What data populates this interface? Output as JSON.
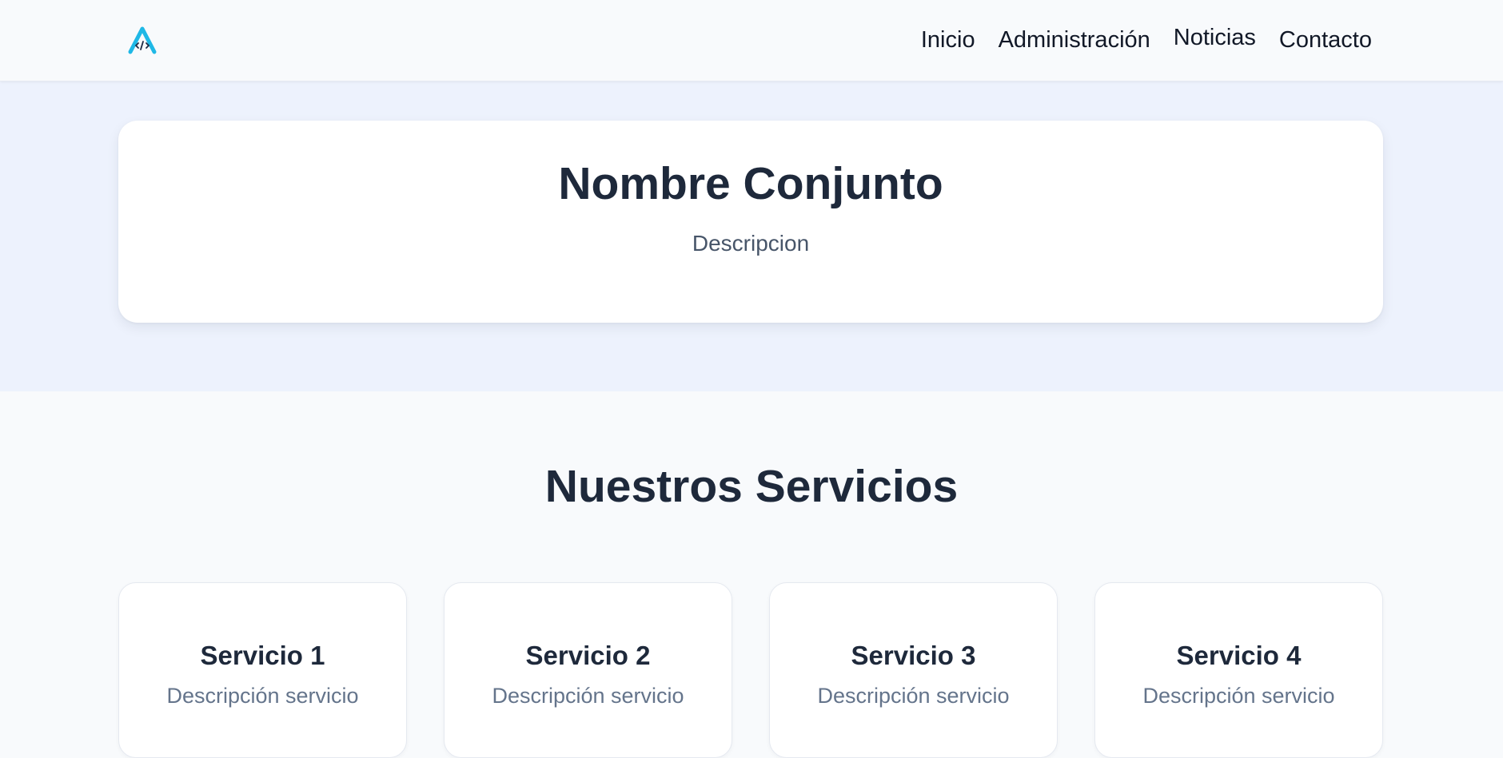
{
  "header": {
    "logo_icon": "code-a-logo-icon",
    "nav": [
      {
        "label": "Inicio"
      },
      {
        "label": "Administración"
      },
      {
        "label": "Noticias"
      },
      {
        "label": "Contacto"
      }
    ]
  },
  "hero": {
    "title": "Nombre Conjunto",
    "description": "Descripcion"
  },
  "services": {
    "title": "Nuestros Servicios",
    "items": [
      {
        "title": "Servicio 1",
        "description": "Descripción servicio"
      },
      {
        "title": "Servicio 2",
        "description": "Descripción servicio"
      },
      {
        "title": "Servicio 3",
        "description": "Descripción servicio"
      },
      {
        "title": "Servicio 4",
        "description": "Descripción servicio"
      }
    ]
  },
  "colors": {
    "accent": "#1fb8e6",
    "text_dark": "#1e293b",
    "text_muted": "#475569",
    "hero_background": "#edf2fd",
    "page_background": "#f8fafc"
  }
}
